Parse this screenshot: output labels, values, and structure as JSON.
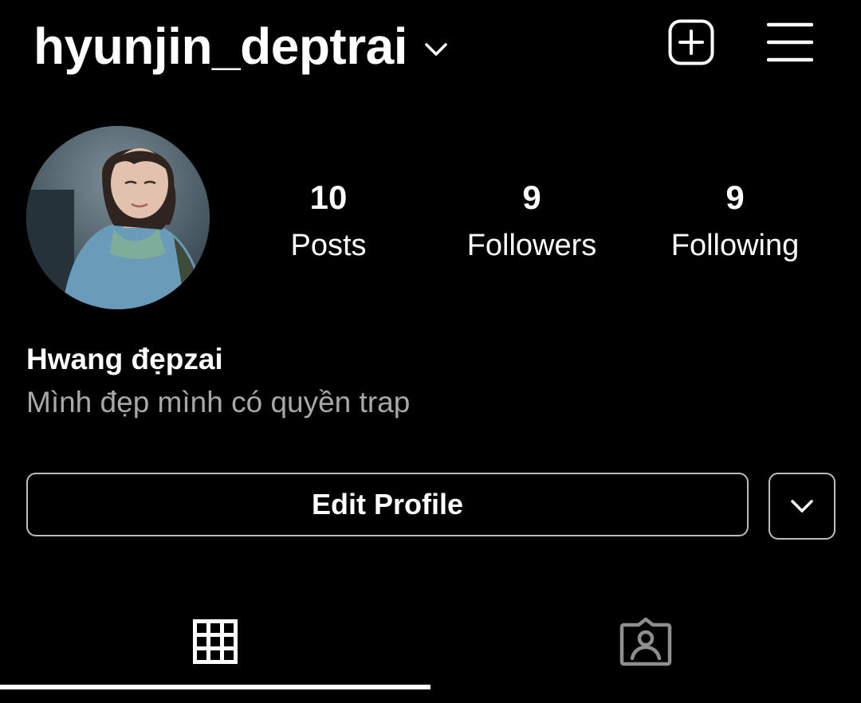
{
  "header": {
    "username": "hyunjin_deptrai",
    "username_dropdown_icon": "chevron-down-icon",
    "new_post_icon": "plus-square-icon",
    "menu_icon": "hamburger-menu-icon"
  },
  "profile": {
    "avatar": "profile-photo",
    "stats": [
      {
        "value": "10",
        "label": "Posts"
      },
      {
        "value": "9",
        "label": "Followers"
      },
      {
        "value": "9",
        "label": "Following"
      }
    ],
    "display_name": "Hwang đẹpzai",
    "bio": "Mình đẹp mình có quyền trap"
  },
  "actions": {
    "edit_profile_label": "Edit Profile",
    "expand_icon": "chevron-down-icon"
  },
  "tabs": [
    {
      "name": "posts-grid",
      "icon": "grid-icon",
      "active": true
    },
    {
      "name": "tagged",
      "icon": "tagged-person-icon",
      "active": false
    }
  ],
  "colors": {
    "background": "#000000",
    "text": "#ffffff",
    "secondary_text": "#a8a8a8",
    "border": "#bdbdbd"
  }
}
